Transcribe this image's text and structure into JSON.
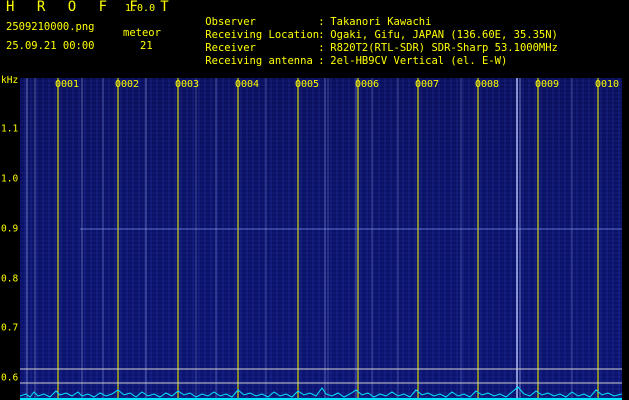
{
  "header": {
    "app_title": "H R O F F T",
    "app_version": "1.0.0",
    "file_name": "2509210000.png",
    "date_time": "25.09.21 00:00",
    "meteor_label": "meteor",
    "meteor_count": "21"
  },
  "info": [
    {
      "key": "Observer",
      "value": "Takanori Kawachi"
    },
    {
      "key": "Receiving Location",
      "value": "Ogaki, Gifu, JAPAN (136.60E, 35.35N)"
    },
    {
      "key": "Receiver",
      "value": "R820T2(RTL-SDR) SDR-Sharp 53.1000MHz"
    },
    {
      "key": "Receiving antenna",
      "value": "2el-HB9CV Vertical (el. E-W)"
    }
  ],
  "axis": {
    "y_unit": "kHz",
    "y_ticks": [
      "1.1",
      "1.0",
      "0.9",
      "0.8",
      "0.7",
      "0.6"
    ],
    "x_ticks": [
      "0001",
      "0002",
      "0003",
      "0004",
      "0005",
      "0006",
      "0007",
      "0008",
      "0009",
      "0010"
    ]
  },
  "colors": {
    "label": "#ffff00",
    "background": "#000000",
    "spectrum_bg": "#0b136e",
    "trace": "#00e5ff"
  }
}
